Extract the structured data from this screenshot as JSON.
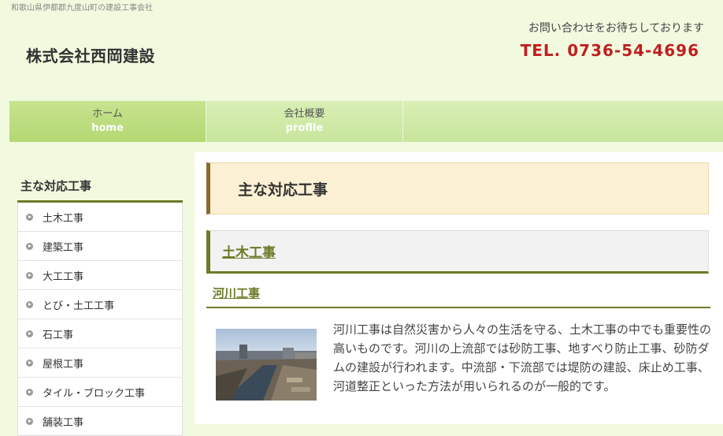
{
  "header": {
    "tagline": "和歌山県伊都郡九度山町の建設工事会社",
    "site_title": "株式会社西岡建設",
    "contact_message": "お問い合わせをお待ちしております",
    "tel": "TEL. 0736-54-4696"
  },
  "nav": {
    "items": [
      {
        "label_jp": "ホーム",
        "label_en": "home"
      },
      {
        "label_jp": "会社概要",
        "label_en": "profile"
      }
    ]
  },
  "sidebar": {
    "title": "主な対応工事",
    "items": [
      {
        "label": "土木工事"
      },
      {
        "label": "建築工事"
      },
      {
        "label": "大工工事"
      },
      {
        "label": "とび・土工工事"
      },
      {
        "label": "石工事"
      },
      {
        "label": "屋根工事"
      },
      {
        "label": "タイル・ブロック工事"
      },
      {
        "label": "舗装工事"
      }
    ]
  },
  "main": {
    "page_heading": "主な対応工事",
    "section_heading": "土木工事",
    "sub_heading": "河川工事",
    "body_text": "河川工事は自然災害から人々の生活を守る、土木工事の中でも重要性の高いものです。河川の上流部では砂防工事、地すべり防止工事、砂防ダムの建設が行われます。中流部・下流部では堤防の建設、床止め工事、河道整正といった方法が用いられるのが一般的です。"
  },
  "colors": {
    "accent": "#6b7b28",
    "tel": "#c01f1f",
    "background": "#f1fadf",
    "nav": "#c7e59b"
  }
}
